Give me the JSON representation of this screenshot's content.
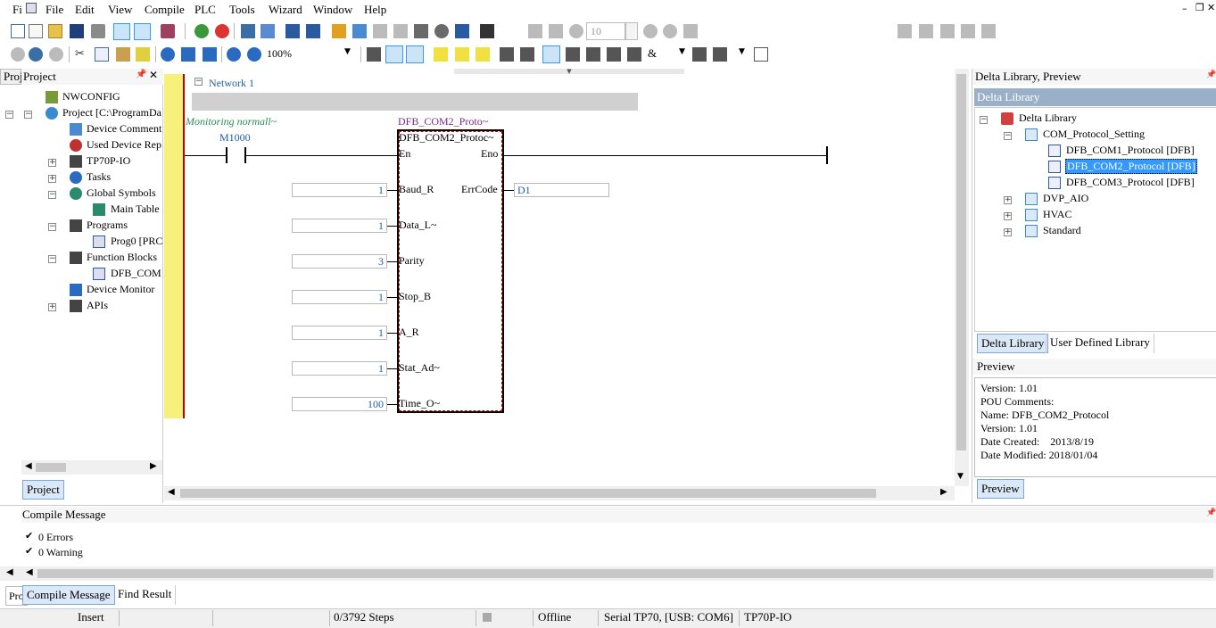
{
  "menu": {
    "file_cut": "Fi",
    "items": [
      "File",
      "Edit",
      "View",
      "Compile",
      "PLC",
      "Tools",
      "Wizard",
      "Window",
      "Help"
    ]
  },
  "toolbar": {
    "zoom": "100%",
    "counter": "10"
  },
  "project_panel": {
    "tab_cut": "Proj",
    "title": "Project",
    "bottom_tab": "Project",
    "tree": [
      "NWCONFIG",
      "Project [C:\\ProgramDa",
      "Device Comment",
      "Used Device Rep",
      "TP70P-IO",
      "Tasks",
      "Global Symbols",
      "Main Table",
      "Programs",
      "Prog0 [PRC",
      "Function Blocks",
      "DFB_COM",
      "Device Monitor",
      "APIs"
    ]
  },
  "ladder": {
    "network_label": "Network 1",
    "monitor_text": "Monitoring normall~",
    "contact_label": "M1000",
    "fb_instance": "DFB_COM2_Proto~",
    "fb_type": "DFB_COM2_Protoc~",
    "en": "En",
    "eno": "Eno",
    "inputs": [
      {
        "value": "1",
        "pin": "Baud_R"
      },
      {
        "value": "1",
        "pin": "Data_L~"
      },
      {
        "value": "3",
        "pin": "Parity"
      },
      {
        "value": "1",
        "pin": "Stop_B"
      },
      {
        "value": "1",
        "pin": "A_R"
      },
      {
        "value": "1",
        "pin": "Stat_Ad~"
      },
      {
        "value": "100",
        "pin": "Time_O~"
      }
    ],
    "output": {
      "pin": "ErrCode",
      "value": "D1"
    }
  },
  "library": {
    "title": "Delta Library, Preview",
    "header": "Delta Library",
    "root": "Delta Library",
    "group": "COM_Protocol_Setting",
    "items": [
      "DFB_COM1_Protocol [DFB]",
      "DFB_COM2_Protocol [DFB]",
      "DFB_COM3_Protocol [DFB]"
    ],
    "others": [
      "DVP_AIO",
      "HVAC",
      "Standard"
    ],
    "tabs": [
      "Delta Library",
      "User Defined Library"
    ]
  },
  "preview": {
    "title": "Preview",
    "lines": [
      "Version: 1.01",
      "POU Comments:",
      "Name: DFB_COM2_Protocol",
      "Version: 1.01",
      "Date Created:    2013/8/19",
      "Date Modified: 2018/01/04"
    ],
    "tab": "Preview"
  },
  "compile": {
    "title": "Compile Message",
    "errors": "0 Errors",
    "warnings": "0 Warning",
    "tabs": [
      "Compile Message",
      "Find Result"
    ],
    "tab_cut": "Pro"
  },
  "status": {
    "mode": "Insert",
    "steps": "0/3792 Steps",
    "conn": "Offline",
    "port": "Serial TP70, [USB: COM6]",
    "device": "TP70P-IO"
  },
  "colors": {
    "select": "#3399ff",
    "ladder_rail": "#f5f17a",
    "rail_line": "#c00000",
    "link": "#1f5da8",
    "monitor": "#2e8b57",
    "fb_title": "#7a2a8a"
  }
}
